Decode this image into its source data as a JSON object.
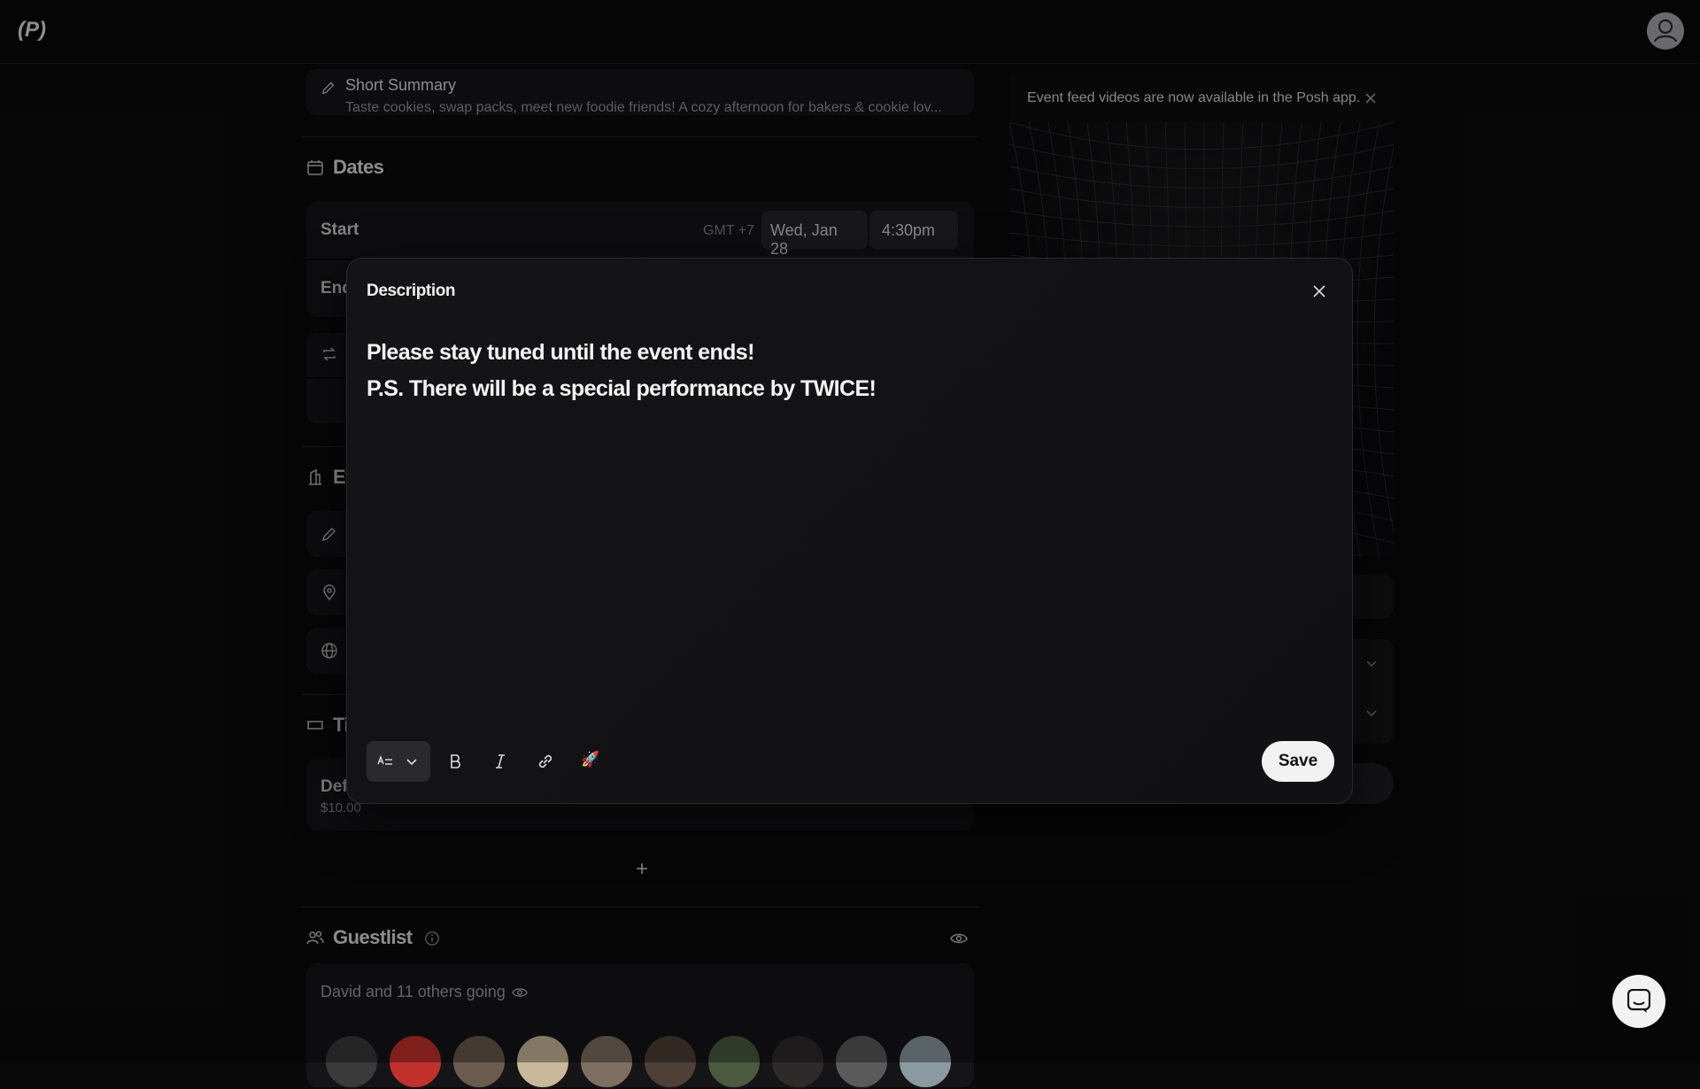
{
  "topbar": {
    "logo_text": "(P)"
  },
  "summary": {
    "title": "Short Summary",
    "text": "Taste cookies, swap packs, meet new foodie friends! A cozy afternoon for bakers & cookie lov..."
  },
  "dates": {
    "title": "Dates",
    "start_label": "Start",
    "timezone": "GMT +7",
    "start_date": "Wed, Jan 28",
    "start_time": "4:30pm",
    "end_label": "End"
  },
  "event_section": {
    "title_partial": "Ev"
  },
  "tickets": {
    "title_partial": "Ti",
    "ticket_name_partial": "Def",
    "ticket_price": "$10.00",
    "add_symbol": "+"
  },
  "guestlist": {
    "title": "Guestlist",
    "going_text": "David and 11 others going",
    "avatar_colors": [
      "#3a3a3a",
      "#c2312b",
      "#6b5a4e",
      "#c9b89a",
      "#7f6e62",
      "#4e4036",
      "#4b5a3f",
      "#2d2a2a",
      "#5a5a5a",
      "#8a9aa0"
    ]
  },
  "right_pane": {
    "banner_text": "Event feed videos are now available in the Posh app."
  },
  "modal": {
    "title": "Description",
    "lines": [
      "Please stay tuned until the event ends!",
      "P.S. There will be a special performance by TWICE!"
    ],
    "save_label": "Save",
    "rocket_glyph": "🚀"
  }
}
